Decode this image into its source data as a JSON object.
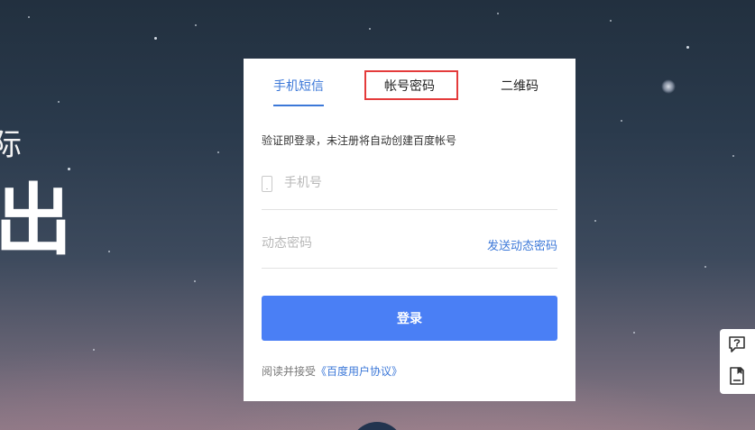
{
  "background": {
    "slogan_small": "际",
    "slogan_big": "出"
  },
  "login": {
    "tabs": [
      {
        "label": "手机短信",
        "active": true
      },
      {
        "label": "帐号密码",
        "active": false,
        "highlighted": true
      },
      {
        "label": "二维码",
        "active": false
      }
    ],
    "notice": "验证即登录，未注册将自动创建百度帐号",
    "phone_placeholder": "手机号",
    "code_placeholder": "动态密码",
    "send_code_label": "发送动态密码",
    "login_button_label": "登录",
    "agreement_prefix": "阅读并接受",
    "agreement_link": "《百度用户协议》"
  },
  "side_tools": {
    "help_icon": "help-icon",
    "feedback_icon": "feedback-icon"
  },
  "colors": {
    "accent": "#3c78d8",
    "button": "#4a7ff5",
    "highlight_border": "#e43b3b"
  }
}
